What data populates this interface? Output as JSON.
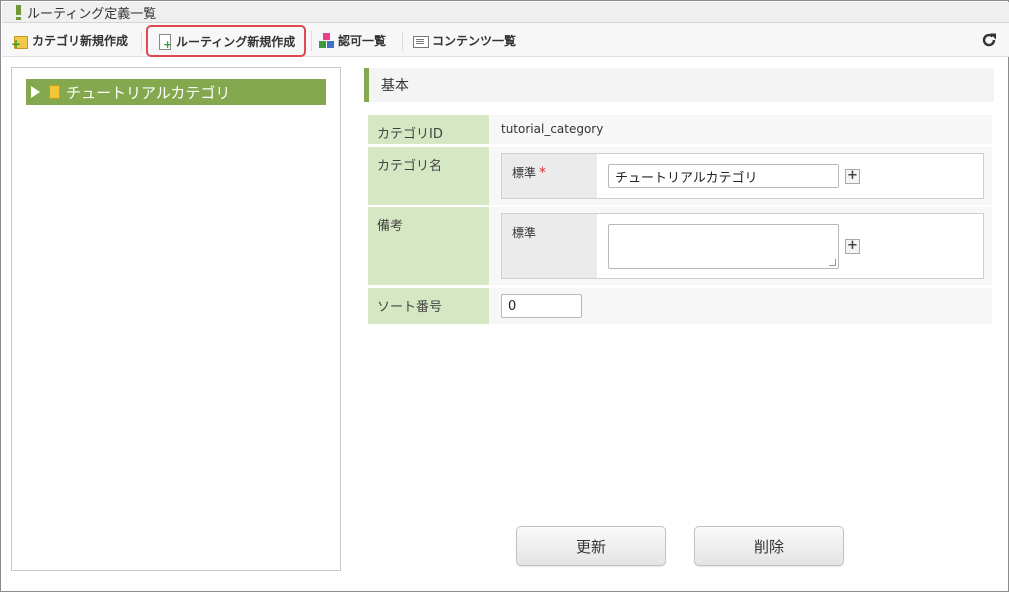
{
  "window": {
    "title": "ルーティング定義一覧"
  },
  "toolbar": {
    "new_category": "カテゴリ新規作成",
    "new_routing": "ルーティング新規作成",
    "auth_list": "認可一覧",
    "content_list": "コンテンツ一覧",
    "highlight_color": "#e0484f"
  },
  "tree": {
    "nodes": [
      {
        "label": "チュートリアルカテゴリ",
        "icon": "folder-icon"
      }
    ]
  },
  "form": {
    "section_title": "基本",
    "category_id": {
      "label": "カテゴリID",
      "value": "tutorial_category"
    },
    "category_name": {
      "label": "カテゴリ名",
      "locale_label": "標準",
      "required_mark": "*",
      "value": "チュートリアルカテゴリ"
    },
    "remarks": {
      "label": "備考",
      "locale_label": "標準",
      "value": ""
    },
    "sort_order": {
      "label": "ソート番号",
      "value": "0"
    }
  },
  "actions": {
    "update": "更新",
    "delete": "削除"
  },
  "colors": {
    "accent": "#84a84e",
    "label_bg": "#d6e8c3"
  }
}
